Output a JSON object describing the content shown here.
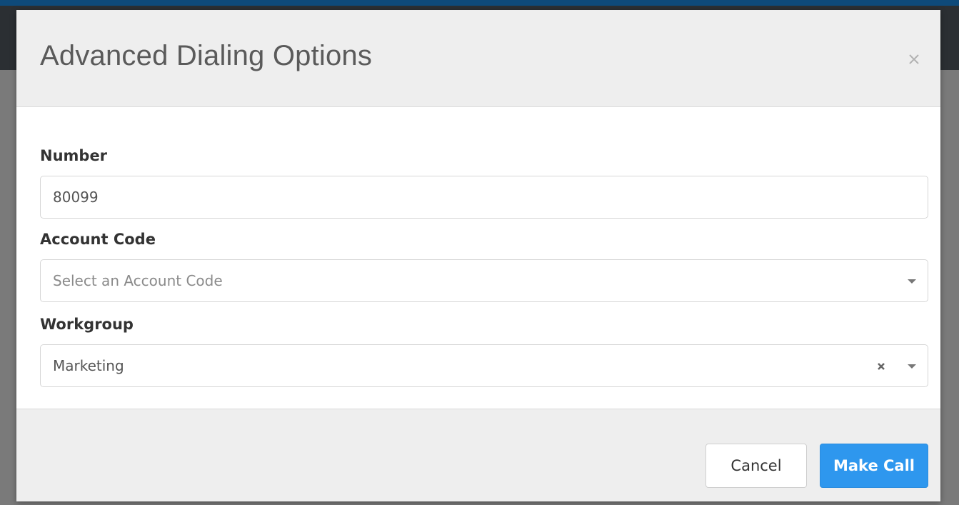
{
  "modal": {
    "title": "Advanced Dialing Options",
    "close_icon": "close-icon"
  },
  "form": {
    "number": {
      "label": "Number",
      "value": "80099"
    },
    "account_code": {
      "label": "Account Code",
      "placeholder": "Select an Account Code",
      "value": ""
    },
    "workgroup": {
      "label": "Workgroup",
      "value": "Marketing"
    }
  },
  "footer": {
    "cancel_label": "Cancel",
    "make_call_label": "Make Call"
  },
  "colors": {
    "primary": "#2e97ee",
    "header_bg": "#eeeeee",
    "topbar_accent": "#0e4a7a"
  }
}
